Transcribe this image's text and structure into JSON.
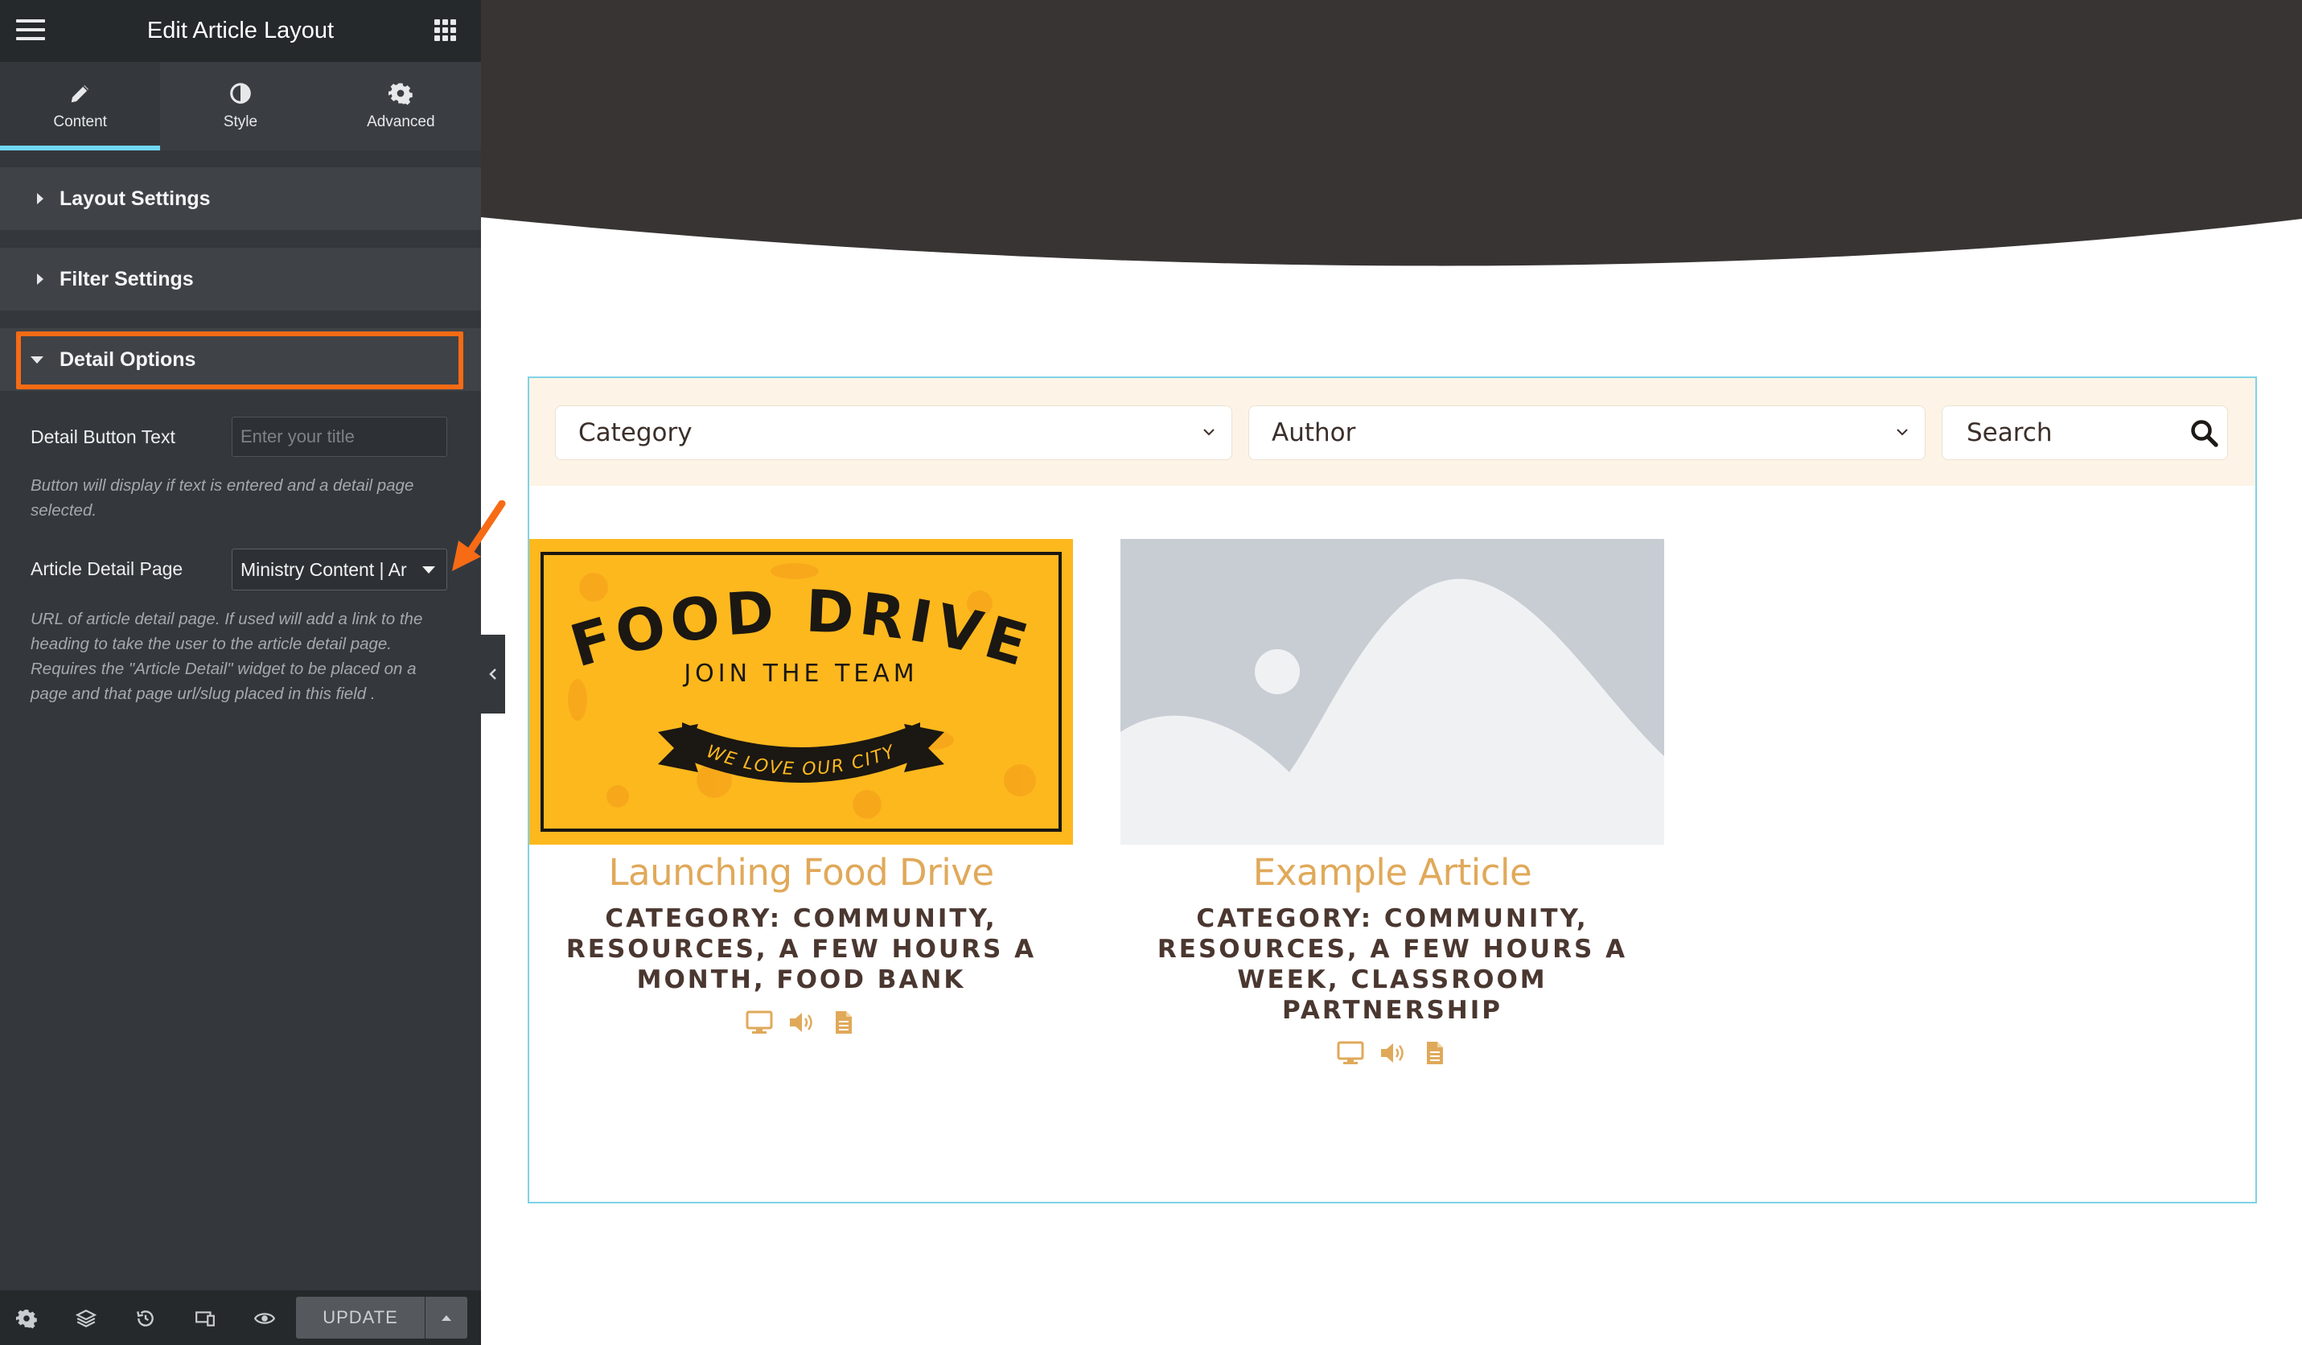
{
  "editor": {
    "title": "Edit Article Layout",
    "tabs": [
      {
        "label": "Content",
        "icon": "pencil-icon",
        "active": true
      },
      {
        "label": "Style",
        "icon": "contrast-icon",
        "active": false
      },
      {
        "label": "Advanced",
        "icon": "gear-icon",
        "active": false
      }
    ],
    "sections": {
      "layout": "Layout Settings",
      "filter": "Filter Settings",
      "detail": "Detail Options"
    },
    "detail_button": {
      "label": "Detail Button Text",
      "placeholder": "Enter your title",
      "value": "",
      "help": "Button will display if text is entered and a detail page selected."
    },
    "article_detail": {
      "label": "Article Detail Page",
      "value": "Ministry Content | Ar",
      "help": "URL of article detail page. If used will add a link to the heading to take the user to the article detail page. Requires the \"Article Detail\" widget to be placed on a page and that page url/slug placed in this field ."
    },
    "footer": {
      "update_label": "UPDATE"
    }
  },
  "colors": {
    "highlight": "#f76b15",
    "accent_tab": "#71d7f7",
    "card_title": "#e0a95a",
    "hero": "#393434"
  },
  "filters": {
    "category": "Category",
    "author": "Author",
    "search_placeholder": "Search"
  },
  "articles": [
    {
      "title": "Launching Food Drive",
      "meta": "CATEGORY: COMMUNITY, RESOURCES, A FEW HOURS A MONTH, FOOD BANK",
      "image": {
        "headline": "FOOD DRIVE",
        "subtitle": "JOIN THE TEAM",
        "banner": "WE LOVE OUR CITY"
      }
    },
    {
      "title": "Example Article",
      "meta": "CATEGORY: COMMUNITY, RESOURCES, A FEW HOURS A WEEK, CLASSROOM PARTNERSHIP",
      "image": "placeholder-image"
    }
  ]
}
